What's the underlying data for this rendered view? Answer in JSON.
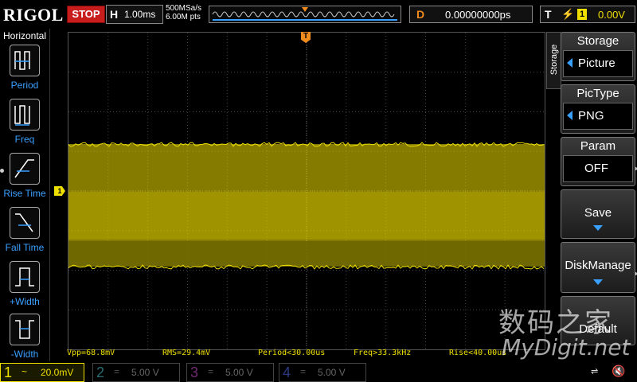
{
  "header": {
    "brand": "RIGOL",
    "run_state": "STOP",
    "timebase_label": "H",
    "timebase_value": "1.00ms",
    "sample_rate": "500MSa/s",
    "memory_depth": "6.00M pts",
    "delay_label": "D",
    "delay_value": "0.00000000ps",
    "trigger_label": "T",
    "trigger_channel": "1",
    "trigger_level": "0.00V"
  },
  "left_menu": {
    "title": "Horizontal",
    "items": [
      {
        "label": "Period",
        "icon": "period-icon"
      },
      {
        "label": "Freq",
        "icon": "freq-icon"
      },
      {
        "label": "Rise Time",
        "icon": "rise-time-icon"
      },
      {
        "label": "Fall Time",
        "icon": "fall-time-icon"
      },
      {
        "label": "+Width",
        "icon": "positive-width-icon"
      },
      {
        "label": "-Width",
        "icon": "negative-width-icon"
      }
    ]
  },
  "measurements": [
    {
      "text": "Vpp=68.8mV"
    },
    {
      "text": "RMS=29.4mV"
    },
    {
      "text": "Period<30.00us"
    },
    {
      "text": "Freq>33.3kHz"
    },
    {
      "text": "Rise<40.00us"
    }
  ],
  "channels": [
    {
      "num": "1",
      "coupling": "~",
      "scale": "20.0mV",
      "color": "#f0e000",
      "active": true
    },
    {
      "num": "2",
      "coupling": "=",
      "scale": "5.00 V",
      "color": "#00c8d8",
      "active": false
    },
    {
      "num": "3",
      "coupling": "=",
      "scale": "5.00 V",
      "color": "#e040e0",
      "active": false
    },
    {
      "num": "4",
      "coupling": "=",
      "scale": "5.00 V",
      "color": "#3a7aff",
      "active": false
    }
  ],
  "right_menu": {
    "tab": "Storage",
    "title": "Storage",
    "items": [
      {
        "title": "Storage",
        "value": "Picture"
      },
      {
        "title": "PicType",
        "value": "PNG"
      },
      {
        "title": "Param",
        "value": "OFF"
      },
      {
        "title": "Save"
      },
      {
        "title": "DiskManage"
      },
      {
        "title": "Default"
      }
    ]
  },
  "status": {
    "usb_icon": "usb-icon",
    "speaker_icon": "speaker-mute-icon"
  },
  "watermark": {
    "line1": "数码之家",
    "line2": "MyDigit.net"
  },
  "colors": {
    "ch1": "#f0e000",
    "trigger": "#f08c1e",
    "accent_blue": "#3aa0ff",
    "stop": "#c81d1d"
  }
}
